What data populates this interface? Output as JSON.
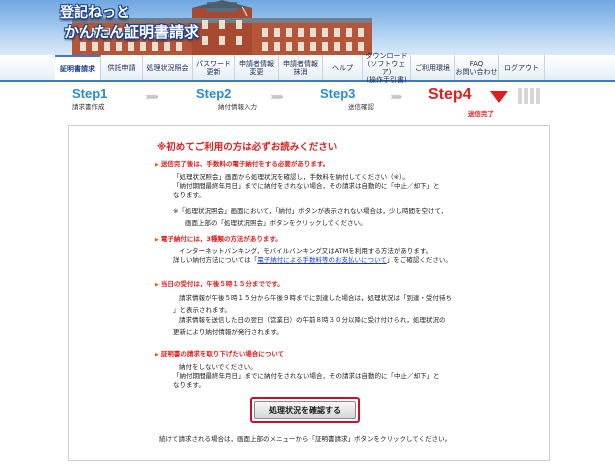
{
  "header": {
    "logo_line1": "登記ねっと",
    "logo_line2": "かんたん証明書請求"
  },
  "menu": [
    {
      "label": "証明書請求",
      "active": true
    },
    {
      "label": "供託申請"
    },
    {
      "label": "処理状況照会"
    },
    {
      "label": "パスワード\n更新"
    },
    {
      "label": "申請者情報\n変更"
    },
    {
      "label": "申請者情報\n抹消"
    },
    {
      "label": "ヘルプ"
    },
    {
      "label": "ダウンロード\n(ソフトウェア)\n(操作手引書)"
    },
    {
      "label": "ご利用環境"
    },
    {
      "label": "FAQ\nお問い合わせ"
    },
    {
      "label": "ログアウト"
    }
  ],
  "steps": [
    {
      "title": "Step1",
      "sub": "請求書作成"
    },
    {
      "title": "Step2",
      "sub": "納付情報入力"
    },
    {
      "title": "Step3",
      "sub": "送信確認"
    },
    {
      "title": "Step4",
      "sub": "送信完了"
    }
  ],
  "content": {
    "title": "※初めてご利用の方は必ずお読みください",
    "s1": "送信完了後は、手数料の電子納付をする必要があります。",
    "s1_l1": "「処理状況照会」画面から処理状況を確認し，手数料を納付してください（※）。",
    "s1_l2": "「納付期間最終年月日」までに納付をされない場合，その請求は自動的に「中止／却下」と",
    "s1_l3": "なります。",
    "s1_l4": "※「処理状況照会」画面において，「納付」ボタンが表示されない場合は，少し時間を空けて，",
    "s1_l5": "画面上部の「処理状況照会」ボタンをクリックしてください。",
    "s2_pre": "電子納付には，",
    "s2_hl": "3種類の方法があります。",
    "s2_l1": "インターネットバンキング，モバイルバンキング又はATMを利用する方法があります。",
    "s2_l2_pre": "詳しい納付方法については「",
    "s2_link": "電子納付による手数料等のお支払いについて",
    "s2_l2_post": "」をご確認ください。",
    "s3_pre": "当日の受付は，",
    "s3_hl": "午後５時１５分までです。",
    "s3_l1": "請求情報が午後５時１５分から午後９時までに到達した場合は，処理状況は「到達・受付待ち",
    "s3_l2": "」と表示されます。",
    "s3_l3": "請求情報を送信した日の翌日（営業日）の午前８時３０分以降に受け付けられ，処理状況の",
    "s3_l4": "更新により納付情報が発行されます。",
    "s4": "証明書の請求を取り下げたい場合について",
    "s4_l1": "納付をしないでください。",
    "s4_l2": "「納付期間最終年月日」までに納付をされない場合，その請求は自動的に「中止／却下」と",
    "s4_l3": "なります。",
    "cta": "処理状況を確認する",
    "footer": "続けて請求される場合は，画面上部のメニューから「証明書請求」ボタンをクリックしてください。"
  }
}
